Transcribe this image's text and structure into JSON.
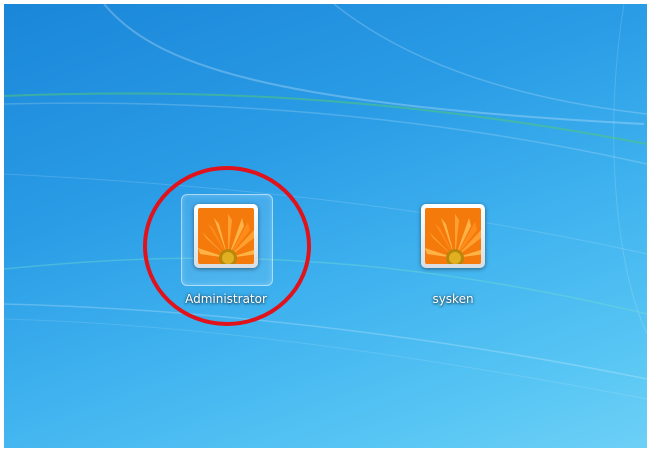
{
  "screen": "Windows 7 welcome screen",
  "users": [
    {
      "name": "Administrator",
      "avatar": "orange-flower-avatar",
      "highlighted": true
    },
    {
      "name": "sysken",
      "avatar": "orange-flower-avatar",
      "highlighted": false
    }
  ],
  "colors": {
    "background_top": "#1a86d8",
    "background_bottom": "#6dd0f6",
    "annotation_red": "#e0121b",
    "flower_orange": "#ff8a1a"
  }
}
